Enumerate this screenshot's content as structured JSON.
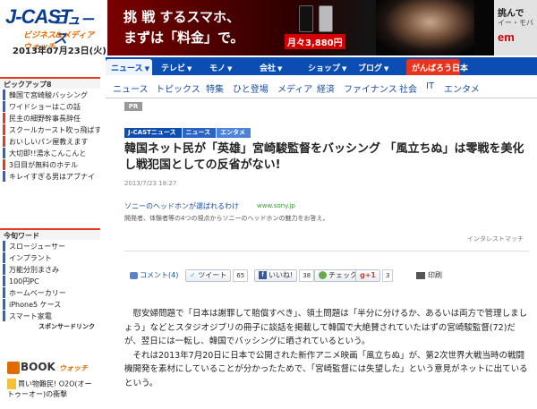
{
  "header": {
    "logo_main": "J-CAST",
    "logo_news": "ニュース",
    "logo_sub": "ビジネス&メディア ウォッチ",
    "date": "2013年07月23日(火)"
  },
  "ad_banner": {
    "line1": "挑 戦 するスマホ、",
    "line2": "まずは「料金」で。",
    "price": "月々3,880円",
    "right_text1": "挑んで",
    "right_text2": "イー・モバ",
    "right_logo": "em"
  },
  "sidebar": {
    "pickup_heading": "ピックアップ8",
    "pickup_items": [
      "韓国で宮崎駿バッシング",
      "ワイドショーはこの話",
      "民主の細野幹事長辞任",
      "スクールカースト吹っ飛ばす",
      "おいしいパン屋教えます",
      "大切即!!湯水こんこんと",
      "3日目が無料のホテル",
      "キレイすぎる男はアブナイ"
    ],
    "wide_heading": "今旬ワード",
    "wide_items": [
      "スロージューサー",
      "インプラント",
      "万能分別まさみ",
      "100円PC",
      "ホームベーカリー",
      "iPhone5 ケース",
      "スマート家電"
    ],
    "wide_more": "スポンサードリンク",
    "book_logo": "BOOK",
    "book_logo_sub": "ウォッチ",
    "book_item": "買い物難民! O2O(オートゥーオー)の衝撃"
  },
  "nav": {
    "tabs": [
      "ニュース",
      "テレビ",
      "モノ",
      "会社",
      "ショップ",
      "ブログ",
      "がんばろう日本"
    ]
  },
  "subnav": {
    "items": [
      "ニュース",
      "トピックス",
      "特集",
      "ひと登場",
      "メディア",
      "経済",
      "ファイナンス",
      "社会",
      "IT",
      "エンタメ"
    ]
  },
  "article": {
    "pr_badge": "PR",
    "breadcrumb": [
      "J-CASTニュース",
      "ニュース",
      "エンタメ"
    ],
    "title": "韓国ネット民が「英雄」宮崎駿監督をバッシング 「風立ちぬ」は零戦を美化し戦犯国としての反省がない!",
    "date": "2013/7/23 18:27",
    "body_p1": "慰安婦問題で「日本は謝罪して賠償すべき」、領土問題は「半分に分けるか、あるいは両方で管理しましょう」などとスタジオジブリの冊子に談話を掲載して韓国で大絶賛されていたはずの宮崎駿監督(72)だが、翌日には一転し、韓国でバッシングに晒されているという。",
    "body_p2": "それは2013年7月20日に日本で公開された新作アニメ映画「風立ちぬ」が、第2次世界大戦当時の戦闘機開発を素材にしていることが分かったためで、「宮崎監督には失望した」という意見がネットに出ているという。"
  },
  "text_ad": {
    "title": "ソニーのヘッドホンが選ばれるわけ",
    "url": "www.sony.jp",
    "description": "開発者、体験者等の4つの視点からソニーのヘッドホンの魅力をお答え。",
    "label": "インタレストマッチ"
  },
  "share": {
    "comment": "コメント(4)",
    "tweet": "ツイート",
    "tweet_count": "65",
    "like": "いいね!",
    "like_count": "38",
    "check": "チェック",
    "check_count": "0",
    "gplus_count": "3",
    "print": "印刷"
  },
  "colors": {
    "brand_blue": "#0b4db3",
    "accent_red": "#e8341d",
    "accent_orange": "#e06b00"
  }
}
